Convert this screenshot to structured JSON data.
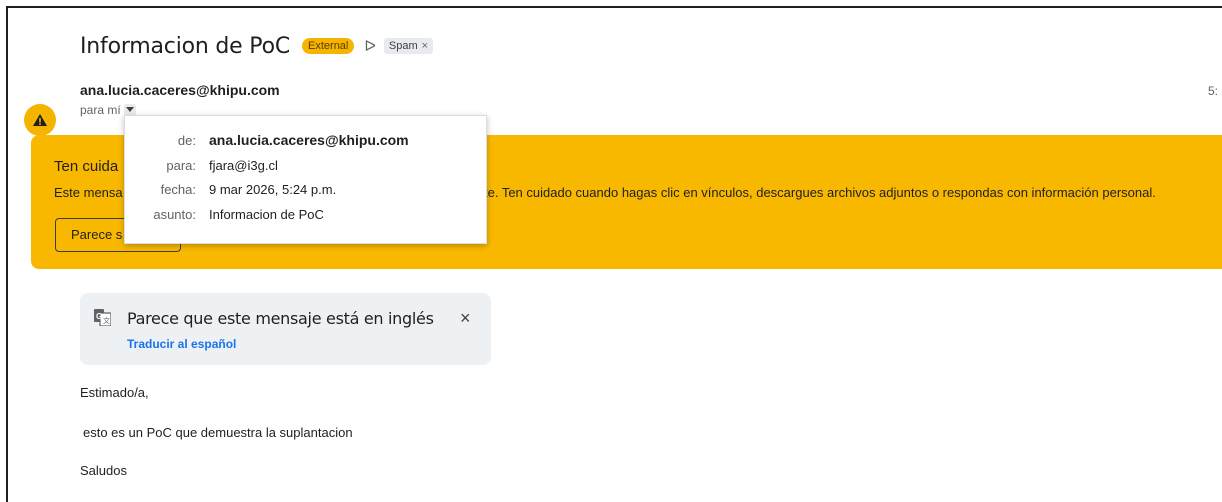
{
  "email": {
    "subject": "Informacion de PoC",
    "labels": {
      "external": "External",
      "spam": "Spam",
      "spam_remove": "×"
    },
    "sender": "ana.lucia.caceres@khipu.com",
    "recipient_prefix": "para mí",
    "time": "5:",
    "body": {
      "greeting": "Estimado/a,",
      "line1": "esto es un PoC que demuestra la suplantacion",
      "signoff": "Saludos"
    }
  },
  "warning_banner": {
    "title": "Ten cuida",
    "text_left": "Este mensa",
    "text_right": "te. Ten cuidado cuando hagas clic en vínculos, descargues archivos adjuntos o respondas con información personal.",
    "button_label": "Parece s"
  },
  "details_popup": {
    "from_key": "de:",
    "from_value": "ana.lucia.caceres@khipu.com",
    "to_key": "para:",
    "to_value": "fjara@i3g.cl",
    "date_key": "fecha:",
    "date_value": "9 mar 2026, 5:24 p.m.",
    "subject_key": "asunto:",
    "subject_value": "Informacion de PoC"
  },
  "translate_bar": {
    "message": "Parece que este mensaje está en inglés",
    "link": "Traducir al español",
    "close": "×"
  },
  "colors": {
    "warning": "#f9b800",
    "external_badge": "#f4b400",
    "link": "#1a73e8"
  },
  "icons": [
    "warning-icon",
    "label-importance-icon",
    "chevron-down-icon",
    "translate-icon",
    "close-icon"
  ]
}
